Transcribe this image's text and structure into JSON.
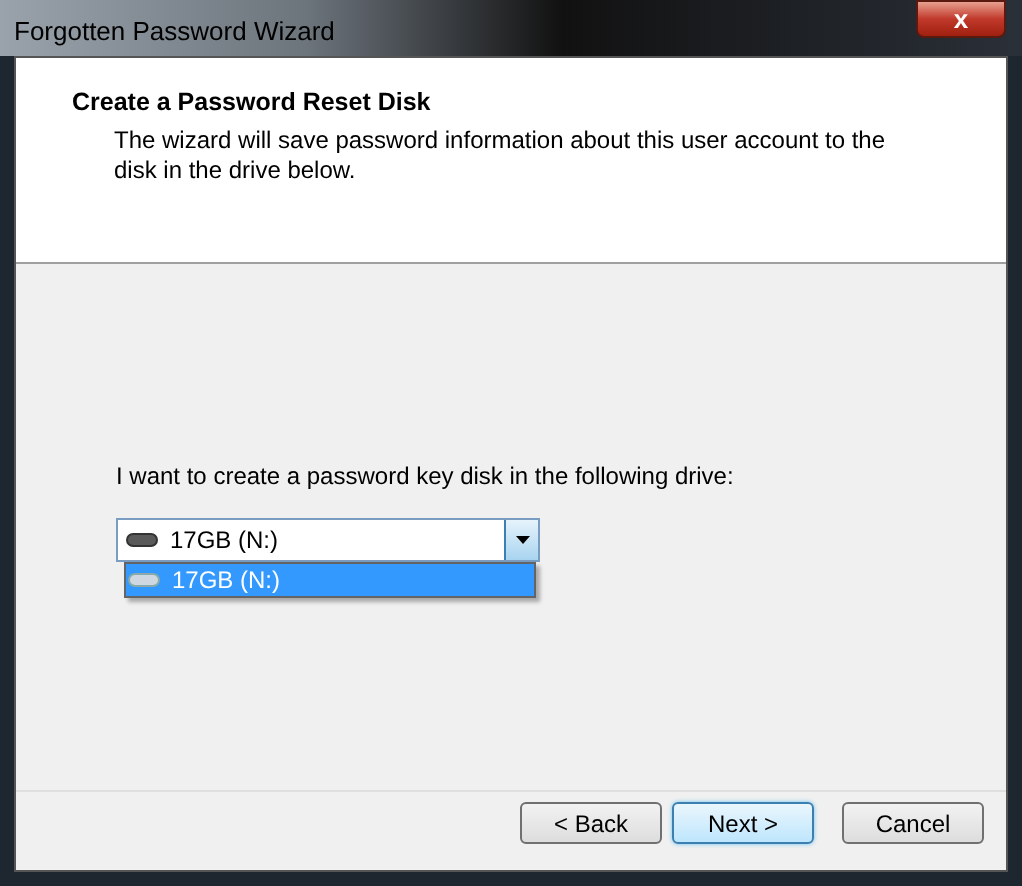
{
  "window": {
    "title": "Forgotten Password Wizard",
    "close": "x"
  },
  "header": {
    "title": "Create a Password Reset Disk",
    "description": "The wizard will save password information about this user account to the disk in the drive below."
  },
  "drive_prompt": "I want to create a password key disk in the following drive:",
  "drive_select": {
    "value": "17GB (N:)",
    "expanded": true,
    "options": [
      {
        "label": "17GB (N:)",
        "selected": true
      }
    ]
  },
  "buttons": [
    {
      "label": "< Back",
      "default": false
    },
    {
      "label": "Next >",
      "default": true
    },
    {
      "label": "Cancel",
      "default": false
    }
  ]
}
